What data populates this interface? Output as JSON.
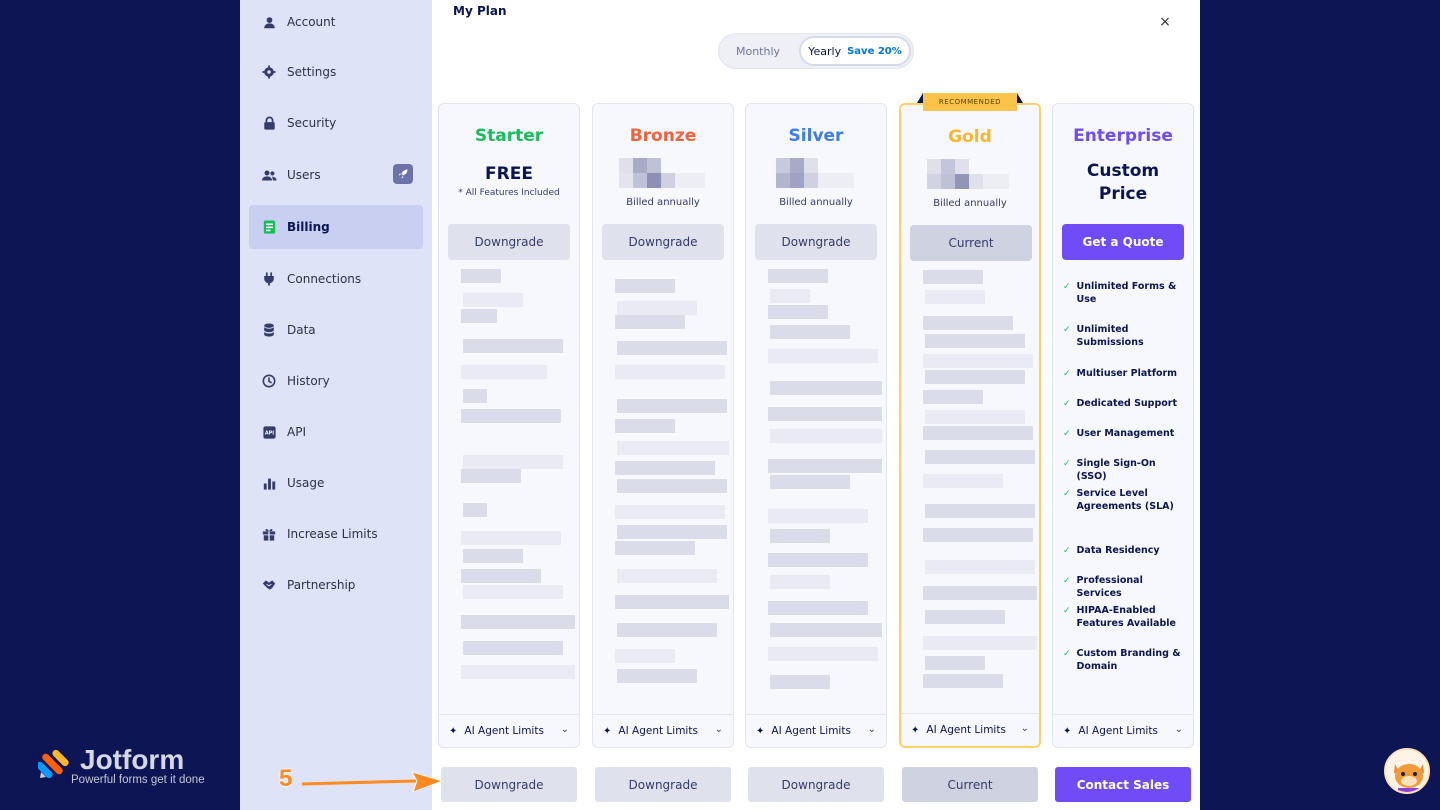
{
  "sidebar": {
    "items": [
      {
        "label": "Account",
        "icon": "user-icon"
      },
      {
        "label": "Settings",
        "icon": "gear-icon"
      },
      {
        "label": "Security",
        "icon": "lock-icon"
      },
      {
        "label": "Users",
        "icon": "users-icon"
      },
      {
        "label": "Billing",
        "icon": "billing-icon",
        "active": true
      },
      {
        "label": "Connections",
        "icon": "plug-icon"
      },
      {
        "label": "Data",
        "icon": "database-icon"
      },
      {
        "label": "History",
        "icon": "history-icon"
      },
      {
        "label": "API",
        "icon": "api-icon"
      },
      {
        "label": "Usage",
        "icon": "bar-chart-icon"
      },
      {
        "label": "Increase Limits",
        "icon": "gift-icon"
      },
      {
        "label": "Partnership",
        "icon": "handshake-icon"
      }
    ]
  },
  "modal": {
    "title": "My Plan",
    "close": "×",
    "toggle": {
      "monthly": "Monthly",
      "yearly": "Yearly",
      "save": "Save 20%"
    }
  },
  "plans": [
    {
      "name": "Starter",
      "color": "#18bd5b",
      "price": "FREE",
      "note": "* All Features Included",
      "button": "Downgrade",
      "footer": "AI Agent Limits",
      "bottom_button": "Downgrade"
    },
    {
      "name": "Bronze",
      "color": "#f0633e",
      "billed": "Billed annually",
      "button": "Downgrade",
      "footer": "AI Agent Limits",
      "bottom_button": "Downgrade"
    },
    {
      "name": "Silver",
      "color": "#3c7ee8",
      "billed": "Billed annually",
      "button": "Downgrade",
      "footer": "AI Agent Limits",
      "bottom_button": "Downgrade"
    },
    {
      "name": "Gold",
      "color": "#f9b62c",
      "badge": "RECOMMENDED",
      "billed": "Billed annually",
      "button": "Current",
      "footer": "AI Agent Limits",
      "bottom_button": "Current"
    },
    {
      "name": "Enterprise",
      "color": "#6f4cf5",
      "price_line1": "Custom",
      "price_line2": "Price",
      "button": "Get a Quote",
      "footer": "AI Agent Limits",
      "bottom_button": "Contact Sales",
      "features": [
        "Unlimited Forms & Use",
        "Unlimited Submissions",
        "Multiuser Platform",
        "Dedicated Support",
        "User Management",
        "Single Sign-On (SSO)",
        "Service Level Agreements (SLA)",
        "Data Residency",
        "Professional Services",
        "HIPAA-Enabled Features Available",
        "Custom Branding & Domain"
      ]
    }
  ],
  "logo": {
    "name": "Jotform",
    "tagline": "Powerful forms get it done"
  },
  "annotation": {
    "step": "5"
  },
  "colors": {
    "background": "#0d1554",
    "sidebar": "#dfe3f7",
    "accent": "#6f4cf5",
    "annotation": "#ff8a1f"
  }
}
